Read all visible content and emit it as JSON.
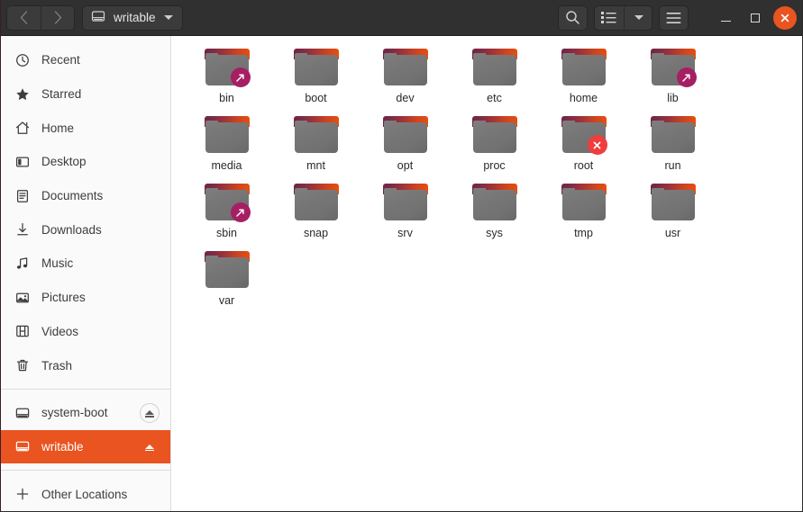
{
  "window": {
    "title": "writable",
    "colors": {
      "accent": "#e95420",
      "headerbar_bg": "#303030",
      "sidebar_bg": "#fafafa",
      "content_bg": "#ffffff",
      "symlink_emblem": "#a61f62",
      "unreadable_emblem": "#f03d3d",
      "folder_gradient_start": "#6e2544",
      "folder_gradient_end": "#e8500f",
      "folder_body": "#757575"
    }
  },
  "headerbar": {
    "back_button": {
      "name": "back-button",
      "icon": "chevron-left-icon",
      "label": "‹",
      "enabled": false
    },
    "forward_button": {
      "name": "forward-button",
      "icon": "chevron-right-icon",
      "label": "›",
      "enabled": false
    },
    "path_button": {
      "icon": "drive-harddisk-icon",
      "label": "writable",
      "dropdown_icon": "chevron-down-icon"
    },
    "search_button": {
      "icon": "search-icon",
      "label": ""
    },
    "view_button": {
      "icon": "list-view-icon",
      "label": ""
    },
    "view_dropdown": {
      "icon": "chevron-down-icon",
      "label": ""
    },
    "menu_button": {
      "icon": "hamburger-menu-icon",
      "label": ""
    },
    "minimize_button": {
      "icon": "minimize-icon",
      "label": ""
    },
    "maximize_button": {
      "icon": "maximize-icon",
      "label": ""
    },
    "close_button": {
      "icon": "close-icon",
      "label": ""
    }
  },
  "sidebar": {
    "groups": [
      {
        "name": "places",
        "items": [
          {
            "label": "Recent",
            "icon": "clock-icon",
            "selected": false
          },
          {
            "label": "Starred",
            "icon": "star-icon",
            "selected": false
          },
          {
            "label": "Home",
            "icon": "home-icon",
            "selected": false
          },
          {
            "label": "Desktop",
            "icon": "desktop-icon",
            "selected": false
          },
          {
            "label": "Documents",
            "icon": "documents-icon",
            "selected": false
          },
          {
            "label": "Downloads",
            "icon": "download-icon",
            "selected": false
          },
          {
            "label": "Music",
            "icon": "music-icon",
            "selected": false
          },
          {
            "label": "Pictures",
            "icon": "pictures-icon",
            "selected": false
          },
          {
            "label": "Videos",
            "icon": "videos-icon",
            "selected": false
          },
          {
            "label": "Trash",
            "icon": "trash-icon",
            "selected": false
          }
        ]
      },
      {
        "name": "devices",
        "items": [
          {
            "label": "system-boot",
            "icon": "drive-harddisk-icon",
            "selected": false,
            "eject": true
          },
          {
            "label": "writable",
            "icon": "drive-harddisk-icon",
            "selected": true,
            "eject": true
          }
        ]
      },
      {
        "name": "network",
        "items": [
          {
            "label": "Other Locations",
            "icon": "plus-icon",
            "selected": false
          }
        ]
      }
    ]
  },
  "files": [
    {
      "name": "bin",
      "type": "folder",
      "emblem": "symlink"
    },
    {
      "name": "boot",
      "type": "folder",
      "emblem": null
    },
    {
      "name": "dev",
      "type": "folder",
      "emblem": null
    },
    {
      "name": "etc",
      "type": "folder",
      "emblem": null
    },
    {
      "name": "home",
      "type": "folder",
      "emblem": null
    },
    {
      "name": "lib",
      "type": "folder",
      "emblem": "symlink"
    },
    {
      "name": "media",
      "type": "folder",
      "emblem": null
    },
    {
      "name": "mnt",
      "type": "folder",
      "emblem": null
    },
    {
      "name": "opt",
      "type": "folder",
      "emblem": null
    },
    {
      "name": "proc",
      "type": "folder",
      "emblem": null
    },
    {
      "name": "root",
      "type": "folder",
      "emblem": "unreadable"
    },
    {
      "name": "run",
      "type": "folder",
      "emblem": null
    },
    {
      "name": "sbin",
      "type": "folder",
      "emblem": "symlink"
    },
    {
      "name": "snap",
      "type": "folder",
      "emblem": null
    },
    {
      "name": "srv",
      "type": "folder",
      "emblem": null
    },
    {
      "name": "sys",
      "type": "folder",
      "emblem": null
    },
    {
      "name": "tmp",
      "type": "folder",
      "emblem": null
    },
    {
      "name": "usr",
      "type": "folder",
      "emblem": null
    },
    {
      "name": "var",
      "type": "folder",
      "emblem": null
    }
  ]
}
